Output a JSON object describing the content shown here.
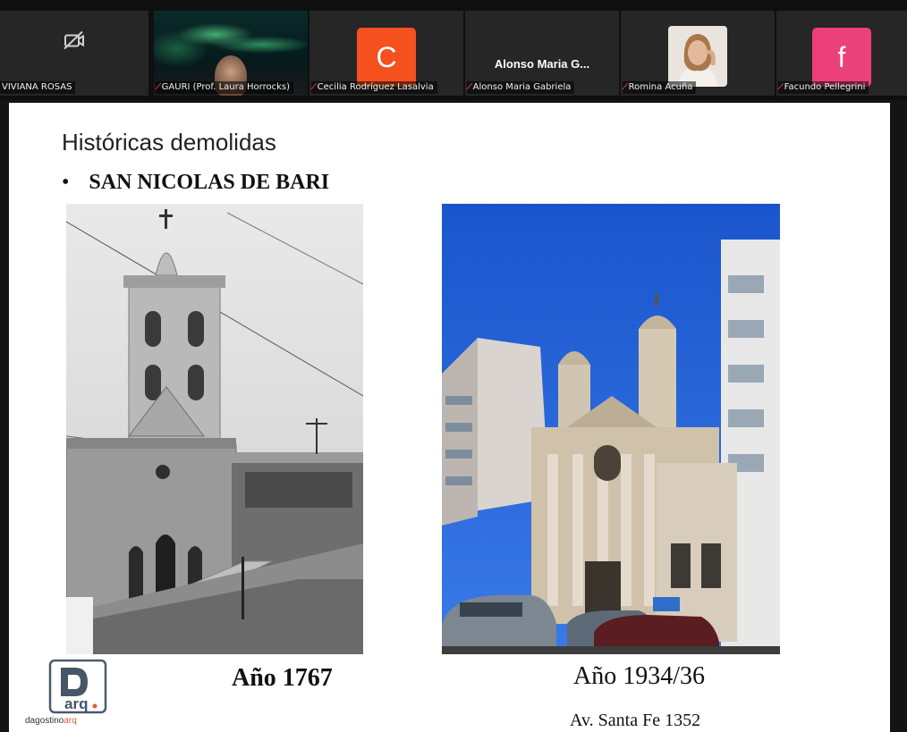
{
  "participants": [
    {
      "name": "VIVIANA ROSAS",
      "video": "off",
      "muted": false,
      "icon": "video-off-icon"
    },
    {
      "name": "GAURI (Prof. Laura Horrocks)",
      "video": "on",
      "muted": true
    },
    {
      "name": "Cecilia Rodríguez Lasalvia",
      "avatar_letter": "C",
      "avatar_color": "#f4511e",
      "muted": true
    },
    {
      "name": "Alonso Maria Gabriela",
      "display_name": "Alonso Maria G...",
      "muted": true
    },
    {
      "name": "Romina Acuña",
      "avatar": "photo",
      "muted": true
    },
    {
      "name": "Facundo Pellegrini",
      "avatar_letter": "f",
      "avatar_color": "#ec407a",
      "muted": true
    }
  ],
  "slide": {
    "title": "Históricas demolidas",
    "bullet": "SAN NICOLAS DE BARI",
    "bullet_marker": "•",
    "left_caption": "Año 1767",
    "right_caption": "Año 1934/36",
    "address": "Av. Santa Fe 1352",
    "logo_letters": "D",
    "logo_sub": "arq.",
    "logo_brand": "dagostino",
    "logo_brand_accent": "arq",
    "accent_color": "#e8583a"
  },
  "colors": {
    "mic_muted": "#e23b3b",
    "sky": "#1f5fd6"
  }
}
